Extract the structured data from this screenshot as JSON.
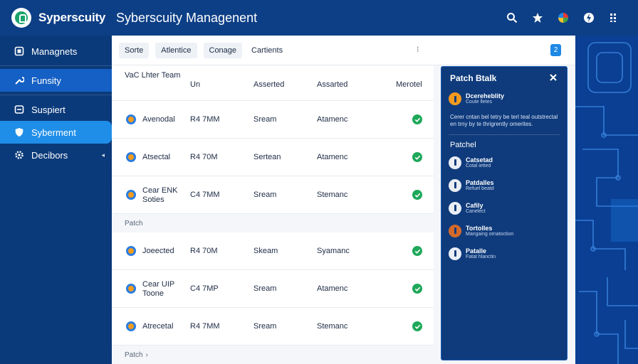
{
  "app": {
    "brand": "Syperscuity",
    "page_title": "Syberscuity Managenent"
  },
  "topbar": {
    "icons": [
      "search-icon",
      "star-icon",
      "colorwheel-icon",
      "bolt-icon",
      "grid-icon"
    ]
  },
  "sidebar": {
    "items": [
      {
        "label": "Managnets",
        "icon": "home-icon"
      },
      {
        "label": "Funsity",
        "icon": "wrench-icon"
      },
      {
        "label": "Suspiert",
        "icon": "layers-icon"
      },
      {
        "label": "Syberment",
        "icon": "shield-icon"
      },
      {
        "label": "Decibors",
        "icon": "gear-icon"
      }
    ]
  },
  "toolbar": {
    "buttons": [
      "Sorte",
      "Atlentice",
      "Conage",
      "Cartients"
    ],
    "chip": "2"
  },
  "table": {
    "headers": [
      "VaC Lhter Team",
      "Un",
      "Asserted",
      "Assarted",
      "Merotel"
    ],
    "rows": [
      {
        "name": "Avenodal",
        "size": "R4 7MM",
        "a": "Sream",
        "b": "Atamenc"
      },
      {
        "name": "Atsectal",
        "size": "R4 70M",
        "a": "Sertean",
        "b": "Atamenc"
      },
      {
        "name": "Cear ENK Soties",
        "size": "C4 7MM",
        "a": "Sream",
        "b": "Stemanc"
      }
    ],
    "group1": "Patch",
    "rows2": [
      {
        "name": "Joeected",
        "size": "R4 70M",
        "a": "Skeam",
        "b": "Syamanc"
      },
      {
        "name": "Cear UIP Toone",
        "size": "C4 7MP",
        "a": "Sream",
        "b": "Atamenc"
      },
      {
        "name": "Atrecetal",
        "size": "R4 7MM",
        "a": "Sream",
        "b": "Stemanc"
      }
    ],
    "group2": "Patch"
  },
  "details": {
    "title": "Patch Btalk",
    "main_item": {
      "title": "Dcereheblity",
      "sub": "Coute lletes"
    },
    "description": "Cerer cntan bel tetry be terl teal outstrectal en trny by te thrigrently omerites.",
    "section": "Patchel",
    "items": [
      {
        "title": "Catsetad",
        "sub": "Cotal ietted",
        "color": "light"
      },
      {
        "title": "Patdalles",
        "sub": "Refuel beatd",
        "color": "light"
      },
      {
        "title": "Cafily",
        "sub": "Canelect",
        "color": "light"
      },
      {
        "title": "Tortolles",
        "sub": "Mangaing ornatoction",
        "color": "brown"
      },
      {
        "title": "Patalle",
        "sub": "Fatat hlanctin",
        "color": "light"
      }
    ]
  },
  "colors": {
    "navy": "#0b3a7a",
    "accent": "#1f8ee8",
    "success": "#1fa85a"
  }
}
